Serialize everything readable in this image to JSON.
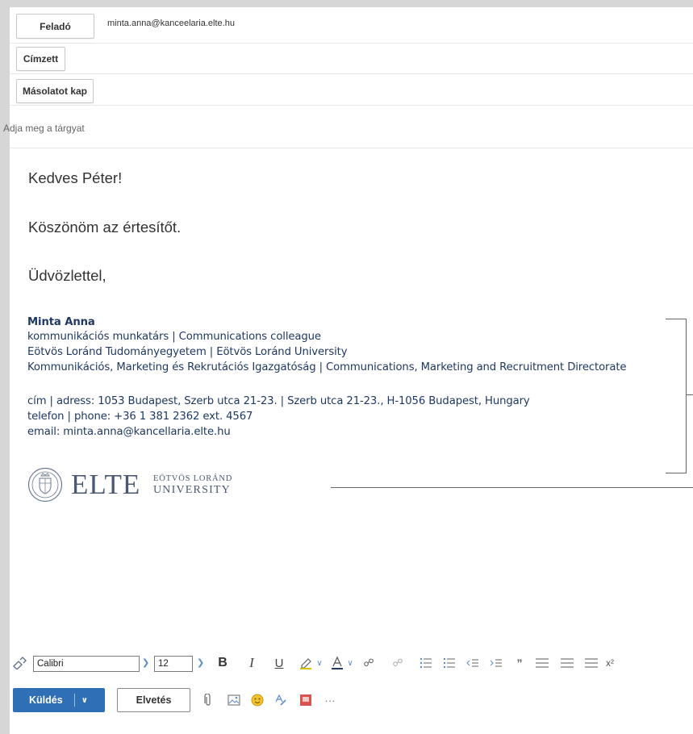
{
  "header": {
    "from_label": "Feladó",
    "from_value": "minta.anna@kanceelaria.elte.hu",
    "to_label": "Címzett",
    "cc_label": "Másolatot kap",
    "subject_placeholder": "Adja meg a tárgyat"
  },
  "body": {
    "greeting": "Kedves Péter!",
    "line": "Köszönöm az értesítőt.",
    "closing": "Üdvözlettel,"
  },
  "signature": {
    "name": "Minta Anna",
    "title": "kommunikációs munkatárs | Communications colleague",
    "org": "Eötvös Loránd Tudományegyetem | Eötvös Loránd University",
    "dept": "Kommunikációs, Marketing és Rekrutációs Igazgatóság | Communications, Marketing and Recruitment Directorate",
    "address": "cím | adress: 1053 Budapest, Szerb utca 21-23. | Szerb utca 21-23., H-1056 Budapest, Hungary",
    "phone": "telefon | phone: +36 1 381 2362 ext. 4567",
    "email": "email: minta.anna@kancellaria.elte.hu",
    "logo_text": "ELTE",
    "logo_sub1": "EÖTVÖS LORÁND",
    "logo_sub2": "UNIVERSITY"
  },
  "format_toolbar": {
    "font": "Calibri",
    "size": "12",
    "bold": "B",
    "italic": "I",
    "underline": "U"
  },
  "actions": {
    "send": "Küldés",
    "discard": "Elvetés",
    "more": "···"
  },
  "colors": {
    "accent": "#2f6fb6",
    "signature_text": "#1f3864"
  }
}
